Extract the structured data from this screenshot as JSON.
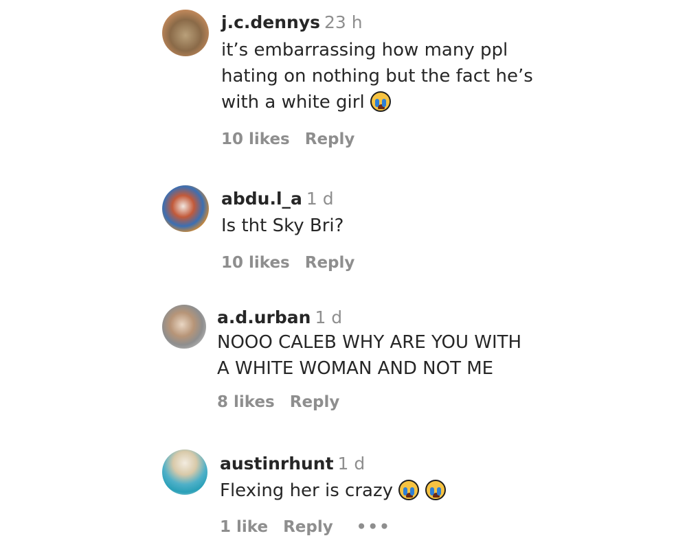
{
  "comments": [
    {
      "username": "j.c.dennys",
      "time": "23 h",
      "lines": [
        "it’s embarrassing how many ppl",
        "hating on nothing but the fact he’s",
        "with a white girl"
      ],
      "line3_emoji": "crying-face-emoji",
      "likes": "10 likes",
      "reply": "Reply"
    },
    {
      "username": "abdu.l_a",
      "time": "1 d",
      "lines": [
        "Is tht Sky Bri?"
      ],
      "likes": "10 likes",
      "reply": "Reply"
    },
    {
      "username": "a.d.urban",
      "time": "1 d",
      "lines": [
        "NOOO CALEB WHY ARE YOU WITH",
        "A WHITE WOMAN AND NOT ME"
      ],
      "likes": "8 likes",
      "reply": "Reply"
    },
    {
      "username": "austinrhunt",
      "time": "1 d",
      "lines": [
        "Flexing her is crazy"
      ],
      "emojis": [
        "crying-face-emoji",
        "crying-face-emoji"
      ],
      "likes": "1 like",
      "reply": "Reply",
      "more": "•••"
    }
  ]
}
